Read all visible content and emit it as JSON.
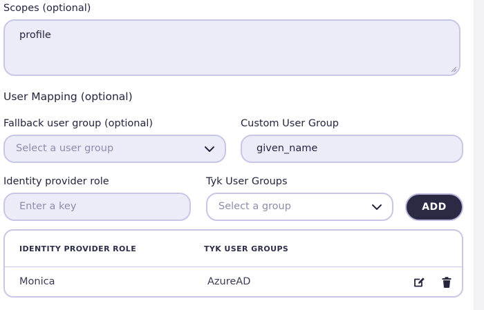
{
  "scopes": {
    "label": "Scopes (optional)",
    "value": "profile"
  },
  "user_mapping": {
    "title": "User Mapping (optional)"
  },
  "fallback_group": {
    "label": "Fallback user group (optional)",
    "placeholder": "Select a user group"
  },
  "custom_user_group": {
    "label": "Custom User Group",
    "value": "given_name"
  },
  "identity_provider_role": {
    "label": "Identity provider role",
    "placeholder": "Enter a key"
  },
  "tyk_user_groups": {
    "label": "Tyk User Groups",
    "placeholder": "Select a group"
  },
  "add_button": {
    "label": "ADD"
  },
  "mapping_table": {
    "columns": [
      "IDENTITY PROVIDER ROLE",
      "TYK USER GROUPS"
    ],
    "rows": [
      {
        "role": "Monica",
        "group": "AzureAD"
      }
    ]
  },
  "icons": {
    "chevron": "chevron-down-icon",
    "edit": "edit-icon",
    "delete": "trash-icon",
    "resize": "resize-handle-icon"
  },
  "colors": {
    "field_bg": "#ececf9",
    "field_border": "#c9c5e6",
    "button_bg": "#2b2a45",
    "text": "#24243f",
    "placeholder": "#8e8cad"
  }
}
